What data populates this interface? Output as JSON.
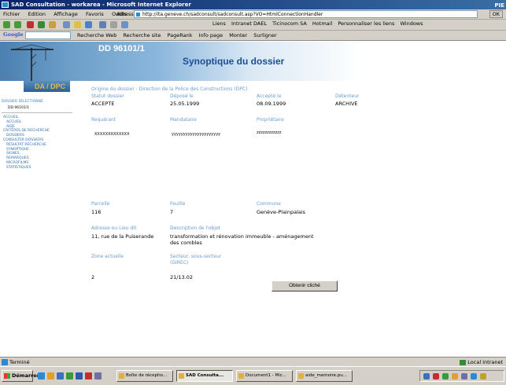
{
  "window": {
    "title": "SAD Consultation - workarea - Microsoft Internet Explorer",
    "controls": "PIE"
  },
  "menu": [
    "Fichier",
    "Edition",
    "Affichage",
    "Favoris",
    "Outils",
    "?"
  ],
  "address": {
    "label": "Adresse",
    "url": "http://ita.geneve.ch/sadconsult/sadconsult.asp?VO=HtmlConnectionHandler",
    "go": "OK"
  },
  "links": [
    "Liens",
    "Intranet DAEL",
    "Ticinocom SA",
    "Hotmail",
    "Personnaliser les liens",
    "Windows"
  ],
  "google": {
    "logo": "Google",
    "items": [
      "Recherche Web",
      "Recherche site",
      "PageRank",
      "Info page",
      "Monter",
      "Surligner"
    ]
  },
  "header": {
    "dossier_id": "DD 96101/1",
    "title": "Synoptique du dossier",
    "dpc": "DA / DPC"
  },
  "nav": {
    "selected_label": "DOSSIER SÉLECTIONNÉ",
    "selected_value": "DD 96101/1",
    "items": [
      {
        "label": "ACCUEIL",
        "child": false
      },
      {
        "label": "ACCUEIL",
        "child": true
      },
      {
        "label": "AIDE",
        "child": true
      },
      {
        "label": "CRITÈRES DE RECHERCHE",
        "child": false
      },
      {
        "label": "DOSSIERS",
        "child": true
      },
      {
        "label": "CONSULTER DOSSIERS",
        "child": false
      },
      {
        "label": "RÉSULTAT RECHERCHE",
        "child": true
      },
      {
        "label": "SYNOPTIQUE",
        "child": true
      },
      {
        "label": "SIGNES",
        "child": true
      },
      {
        "label": "REMARQUES",
        "child": true
      },
      {
        "label": "MICROFILMS",
        "child": true
      },
      {
        "label": "STATISTIQUES",
        "child": true
      }
    ]
  },
  "dossier": {
    "origine": "Origine du dossier : Direction de la Police des Constructions (DPC)",
    "statut_label": "Statut dossier",
    "statut": "ACCEPTE",
    "depose_label": "Déposé le",
    "depose": "25.05.1999",
    "accepte_label": "Accepté le",
    "accepte": "08.09.1999",
    "detenteur_label": "Détenteur",
    "detenteur": "ARCHIVE",
    "requerant_label": "Requérant",
    "requerant": "XXXXXXXXXXXXX",
    "mandataire_label": "Mandataire",
    "mandataire": "yyyyyyyyyyyyyyyyyyyyy",
    "proprietaire_label": "Propriétaire",
    "proprietaire": "zzzzzzzzzzzz",
    "parcelle_label": "Parcelle",
    "parcelle": "116",
    "feuille_label": "Feuille",
    "feuille": "7",
    "commune_label": "Commune",
    "commune": "Genève-Plainpalais",
    "adresse_label": "Adresse ou Lieu dit",
    "adresse": "11, rue de la Puiserande",
    "description_label": "Description de l'objet",
    "description_1": "transformation et rénovation immeuble - aménagement",
    "description_2": "des combles",
    "zone_label": "Zone actuelle",
    "zone": "2",
    "secteur_label_1": "Secteur, sous-secteur",
    "secteur_label_2": "(GIREC)",
    "secteur": "21/13.02",
    "cliche_button": "Obtenir cliché"
  },
  "status": {
    "text": "Terminé",
    "zone": "Local intranet"
  },
  "taskbar": {
    "start": "Démarrer",
    "tasks": [
      "Boîte de réceptio...",
      "SAD Consulta...",
      "Document1 - Mic...",
      "aide_memoire.pu..."
    ],
    "active_index": 1
  }
}
